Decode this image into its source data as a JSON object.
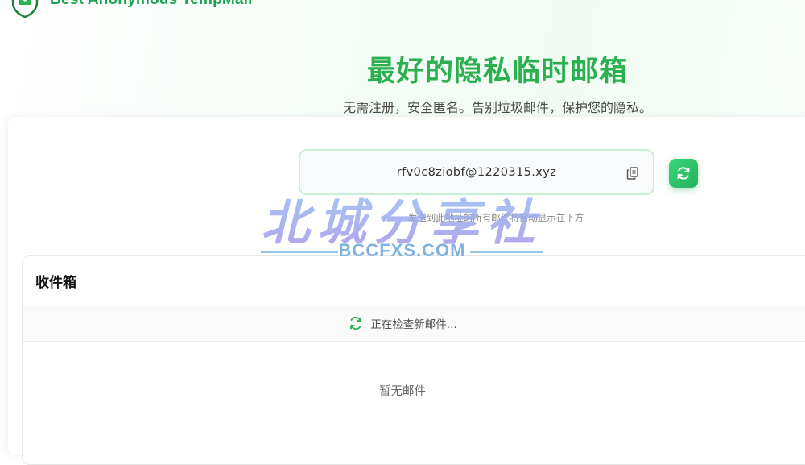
{
  "brand": {
    "name": "Best Anonymous TempMail",
    "logo_icon": "shield-mail-icon",
    "color": "#1aa34a"
  },
  "hero": {
    "title": "最好的隐私临时邮箱",
    "subtitle": "无需注册，安全匿名。告别垃圾邮件，保护您的隐私。",
    "title_color": "#2bb04f"
  },
  "email": {
    "address": "rfv0c8ziobf@1220315.xyz",
    "copy_icon": "copy-icon",
    "refresh_icon": "refresh-icon",
    "hint": "发送到此地址的所有邮件将自动显示在下方"
  },
  "inbox": {
    "title": "收件箱",
    "status": "正在检查新邮件...",
    "status_icon": "sync-icon",
    "empty": "暂无邮件"
  },
  "watermark": {
    "cn": "北城分享社",
    "en": "BCCFXS.COM"
  },
  "colors": {
    "accent": "#22b45a",
    "border": "#c9efd3"
  }
}
